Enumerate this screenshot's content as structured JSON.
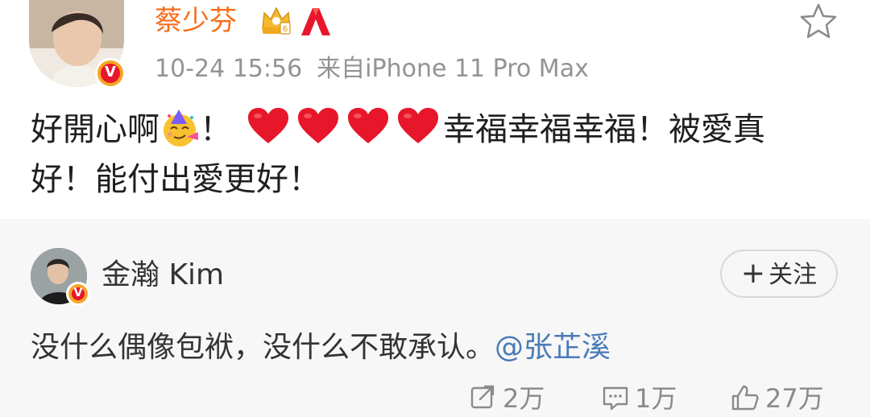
{
  "post": {
    "author": "蔡少芬",
    "timestamp": "10-24 15:56",
    "source": "来自iPhone 11 Pro Max",
    "text_part1": "好開心啊",
    "text_part2": "！",
    "text_part3": "幸福幸福幸福！被愛真",
    "text_part4": "好！能付出愛更好！",
    "verified_badge": "V"
  },
  "repost": {
    "author": "金瀚 Kim",
    "follow_label": "关注",
    "follow_plus": "+",
    "text": "没什么偶像包袱，没什么不敢承认。",
    "mention": "@张芷溪",
    "verified_badge": "V"
  },
  "actions": {
    "share_count": "2万",
    "comment_count": "1万",
    "like_count": "27万"
  },
  "icons": {
    "star": "star-icon",
    "crown": "crown-icon",
    "rank": "rank-icon",
    "heart": "heart-icon",
    "party_face": "party-face-icon",
    "share": "share-icon",
    "comment": "comment-icon",
    "like": "like-icon"
  },
  "colors": {
    "author_name": "#f86d1a",
    "meta_text": "#939393",
    "mention": "#4b7bb8",
    "heart": "#e8162a",
    "verified": "#e6162d",
    "repost_bg": "#f7f7f7"
  }
}
